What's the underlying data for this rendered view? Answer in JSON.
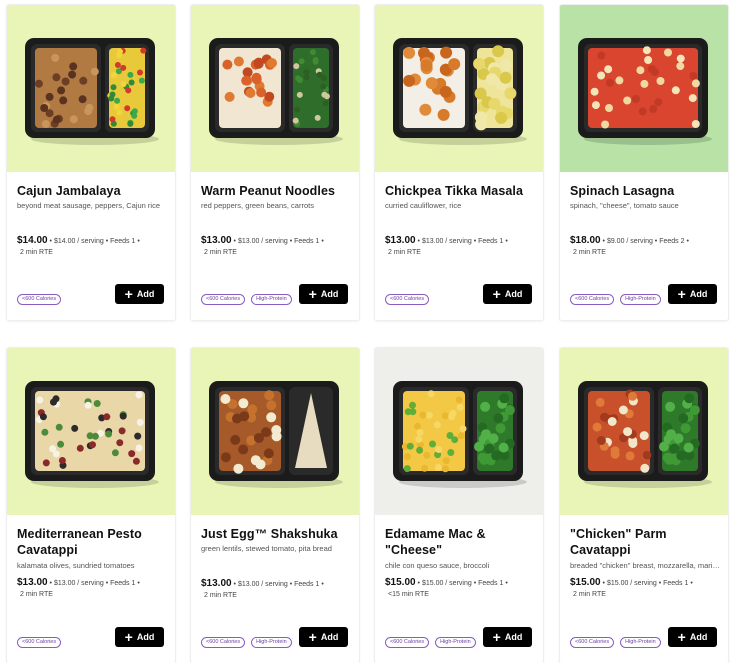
{
  "cards": [
    {
      "title": "Cajun Jambalaya",
      "desc": "beyond meat sausage, peppers, Cajun rice",
      "price": "$14.00",
      "detail": "• $14.00 / serving • Feeds 1 •",
      "rte": "2 min RTE",
      "tags": [
        "<600 Calories"
      ],
      "add": "Add",
      "bg": "#e8f5b6"
    },
    {
      "title": "Warm Peanut Noodles",
      "desc": "red peppers, green beans, carrots",
      "price": "$13.00",
      "detail": "• $13.00 / serving • Feeds 1 •",
      "rte": "2 min RTE",
      "tags": [
        "<600 Calories",
        "High-Protein"
      ],
      "add": "Add",
      "bg": "#e8f5b6"
    },
    {
      "title": "Chickpea Tikka Masala",
      "desc": "curried cauliflower, rice",
      "price": "$13.00",
      "detail": "• $13.00 / serving • Feeds 1 •",
      "rte": "2 min RTE",
      "tags": [
        "<600 Calories"
      ],
      "add": "Add",
      "bg": "#e8f5b6"
    },
    {
      "title": "Spinach Lasagna",
      "desc": "spinach, \"cheese\", tomato sauce",
      "price": "$18.00",
      "detail": "• $9.00 / serving • Feeds 2 •",
      "rte": "2 min RTE",
      "tags": [
        "<600 Calories",
        "High-Protein"
      ],
      "add": "Add",
      "bg": "#b8e2a6"
    },
    {
      "title": "Mediterranean Pesto Cavatappi",
      "desc": "kalamata olives, sundried tomatoes",
      "price": "$13.00",
      "detail": "• $13.00 / serving • Feeds 1 •",
      "rte": "2 min RTE",
      "tags": [
        "<600 Calories"
      ],
      "add": "Add",
      "bg": "#e8f5b6"
    },
    {
      "title": "Just Egg™ Shakshuka",
      "desc": "green lentils, stewed tomato, pita bread",
      "price": "$13.00",
      "detail": "• $13.00 / serving • Feeds 1 •",
      "rte": "2 min RTE",
      "tags": [
        "<600 Calories",
        "High-Protein"
      ],
      "add": "Add",
      "bg": "#e8f5b6"
    },
    {
      "title": "Edamame Mac & \"Cheese\"",
      "desc": "chile con queso sauce, broccoli",
      "price": "$15.00",
      "detail": "• $15.00 / serving • Feeds 1 •",
      "rte": "<15 min RTE",
      "tags": [
        "<600 Calories",
        "High-Protein"
      ],
      "add": "Add",
      "bg": "#eeeeea"
    },
    {
      "title": "\"Chicken\" Parm Cavatappi",
      "desc": "breaded \"chicken\" breast, mozzarella, marinara",
      "price": "$15.00",
      "detail": "• $15.00 / serving • Feeds 1 •",
      "rte": "2 min RTE",
      "tags": [
        "<600 Calories",
        "High-Protein"
      ],
      "add": "Add",
      "bg": "#e8f5b6"
    }
  ]
}
